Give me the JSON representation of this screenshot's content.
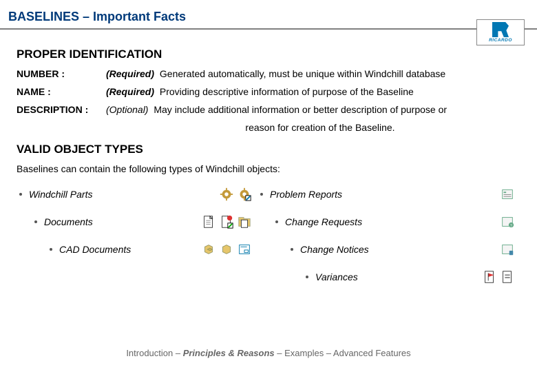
{
  "title": "BASELINES – Important Facts",
  "logo_text": "RICARDO",
  "sections": {
    "ident_heading": "PROPER IDENTIFICATION",
    "objects_heading": "VALID OBJECT TYPES"
  },
  "fields": {
    "number_label": "NUMBER :",
    "number_tag": "(Required)",
    "number_desc": " Generated automatically, must be unique within Windchill database",
    "name_label": "NAME :",
    "name_tag": "(Required)",
    "name_desc": " Providing descriptive information of purpose of the Baseline",
    "desc_label": "DESCRIPTION :",
    "desc_tag": "(Optional)",
    "desc_desc": " May include additional information or better description of purpose or",
    "desc_cont": "reason for creation of the Baseline."
  },
  "objects_intro": "Baselines can contain the following types of Windchill objects:",
  "objects_left": {
    "parts": "Windchill Parts",
    "documents": "Documents",
    "cad": "CAD Documents"
  },
  "objects_right": {
    "problem_reports": "Problem Reports",
    "change_requests": "Change Requests",
    "change_notices": "Change Notices",
    "variances": "Variances"
  },
  "footer": {
    "a": "Introduction – ",
    "b": "Principles & Reasons",
    "c": " – Examples – Advanced Features"
  }
}
